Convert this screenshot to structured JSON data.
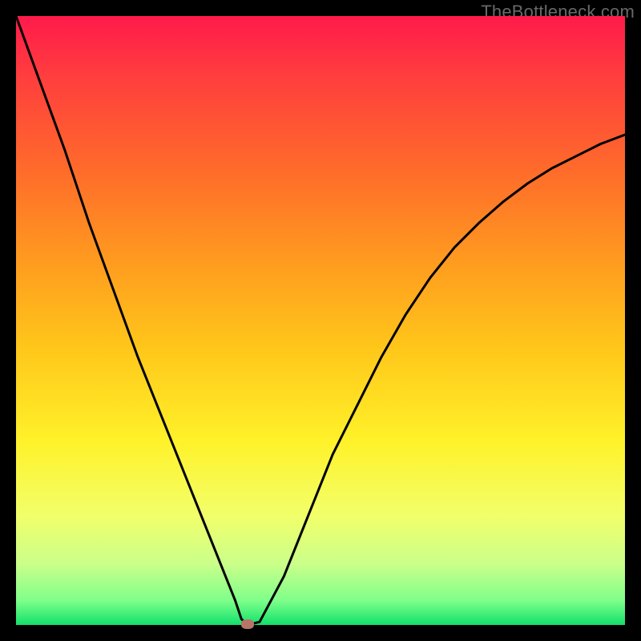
{
  "watermark": "TheBottleneck.com",
  "chart_data": {
    "type": "line",
    "title": "",
    "xlabel": "",
    "ylabel": "",
    "xlim": [
      0,
      100
    ],
    "ylim": [
      0,
      100
    ],
    "x": [
      0,
      4,
      8,
      12,
      16,
      20,
      24,
      28,
      32,
      34,
      36,
      37,
      38,
      40,
      44,
      48,
      52,
      56,
      60,
      64,
      68,
      72,
      76,
      80,
      84,
      88,
      92,
      96,
      100
    ],
    "values": [
      100,
      89,
      78,
      66,
      55,
      44,
      34,
      24,
      14,
      9,
      4,
      1,
      0,
      0.5,
      8,
      18,
      28,
      36,
      44,
      51,
      57,
      62,
      66,
      69.5,
      72.5,
      75,
      77,
      79,
      80.5
    ],
    "marker": {
      "x": 38,
      "y": 0
    },
    "background": "gradient-ryg"
  }
}
